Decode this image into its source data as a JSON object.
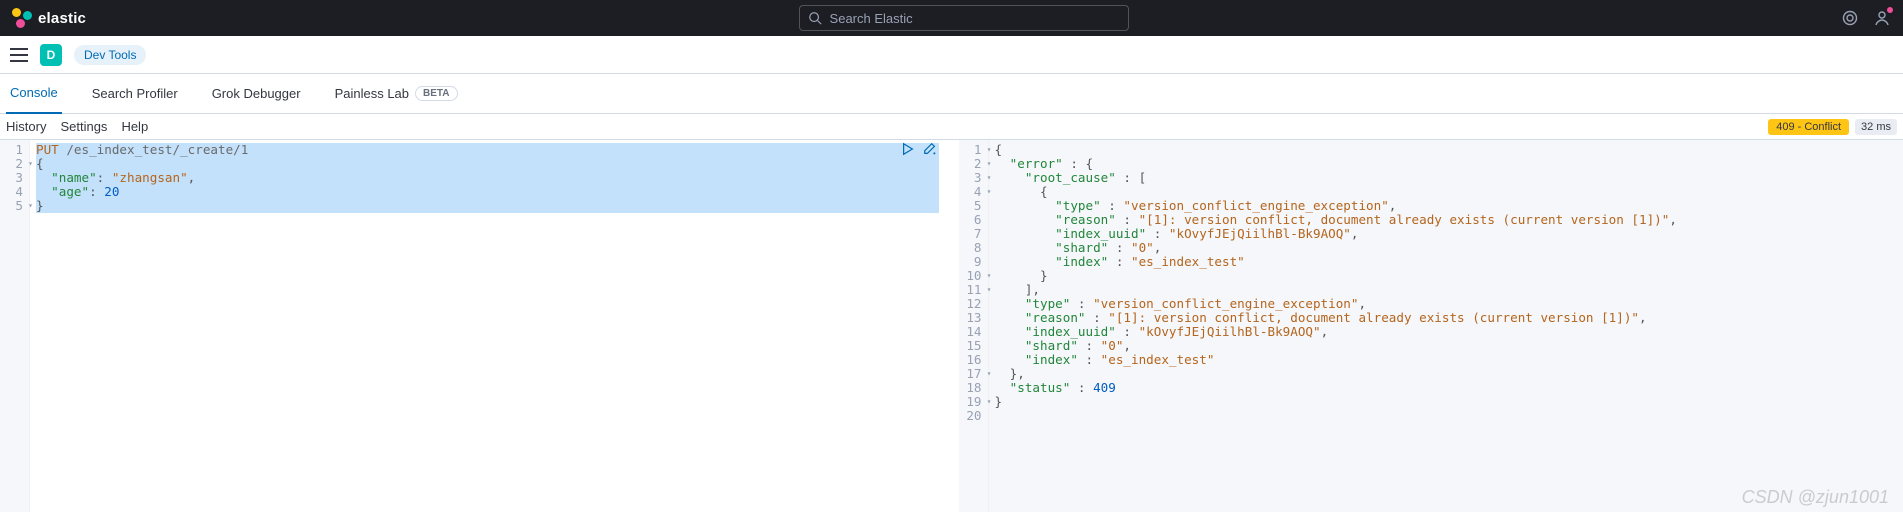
{
  "header": {
    "brand": "elastic",
    "search_placeholder": "Search Elastic"
  },
  "subheader": {
    "app_badge": "D",
    "breadcrumb": "Dev Tools"
  },
  "tabs": [
    {
      "label": "Console",
      "active": true
    },
    {
      "label": "Search Profiler",
      "active": false
    },
    {
      "label": "Grok Debugger",
      "active": false
    },
    {
      "label": "Painless Lab",
      "active": false,
      "badge": "BETA"
    }
  ],
  "toolbar": {
    "items": [
      "History",
      "Settings",
      "Help"
    ],
    "status_text": "409 - Conflict",
    "timing": "32 ms"
  },
  "request": {
    "method": "PUT",
    "path": "/es_index_test/_create/1",
    "body_lines": [
      {
        "n": 1,
        "type": "req"
      },
      {
        "n": 2,
        "text": "{"
      },
      {
        "n": 3,
        "key": "name",
        "val_str": "zhangsan",
        "comma": true,
        "indent": 1
      },
      {
        "n": 4,
        "key": "age",
        "val_num": "20",
        "indent": 1
      },
      {
        "n": 5,
        "text": "}"
      }
    ]
  },
  "response": {
    "lines": [
      {
        "n": 1,
        "txt": "{",
        "fold": true
      },
      {
        "n": 2,
        "ind": 1,
        "key": "error",
        "post": " : {",
        "fold": true
      },
      {
        "n": 3,
        "ind": 2,
        "key": "root_cause",
        "post": " : [",
        "fold": true
      },
      {
        "n": 4,
        "ind": 3,
        "txt": "{",
        "fold": true
      },
      {
        "n": 5,
        "ind": 4,
        "key": "type",
        "str": "version_conflict_engine_exception",
        "comma": true
      },
      {
        "n": 6,
        "ind": 4,
        "key": "reason",
        "str": "[1]: version conflict, document already exists (current version [1])",
        "comma": true
      },
      {
        "n": 7,
        "ind": 4,
        "key": "index_uuid",
        "str": "kOvyfJEjQiilhBl-Bk9AOQ",
        "comma": true
      },
      {
        "n": 8,
        "ind": 4,
        "key": "shard",
        "str": "0",
        "comma": true
      },
      {
        "n": 9,
        "ind": 4,
        "key": "index",
        "str": "es_index_test"
      },
      {
        "n": 10,
        "ind": 3,
        "txt": "}",
        "fold": true
      },
      {
        "n": 11,
        "ind": 2,
        "txt": "],",
        "fold": true
      },
      {
        "n": 12,
        "ind": 2,
        "key": "type",
        "str": "version_conflict_engine_exception",
        "comma": true
      },
      {
        "n": 13,
        "ind": 2,
        "key": "reason",
        "str": "[1]: version conflict, document already exists (current version [1])",
        "comma": true
      },
      {
        "n": 14,
        "ind": 2,
        "key": "index_uuid",
        "str": "kOvyfJEjQiilhBl-Bk9AOQ",
        "comma": true
      },
      {
        "n": 15,
        "ind": 2,
        "key": "shard",
        "str": "0",
        "comma": true
      },
      {
        "n": 16,
        "ind": 2,
        "key": "index",
        "str": "es_index_test"
      },
      {
        "n": 17,
        "ind": 1,
        "txt": "},",
        "fold": true
      },
      {
        "n": 18,
        "ind": 1,
        "key": "status",
        "num": "409"
      },
      {
        "n": 19,
        "txt": "}",
        "fold": true
      },
      {
        "n": 20,
        "txt": ""
      }
    ]
  },
  "watermark": "CSDN @zjun1001"
}
